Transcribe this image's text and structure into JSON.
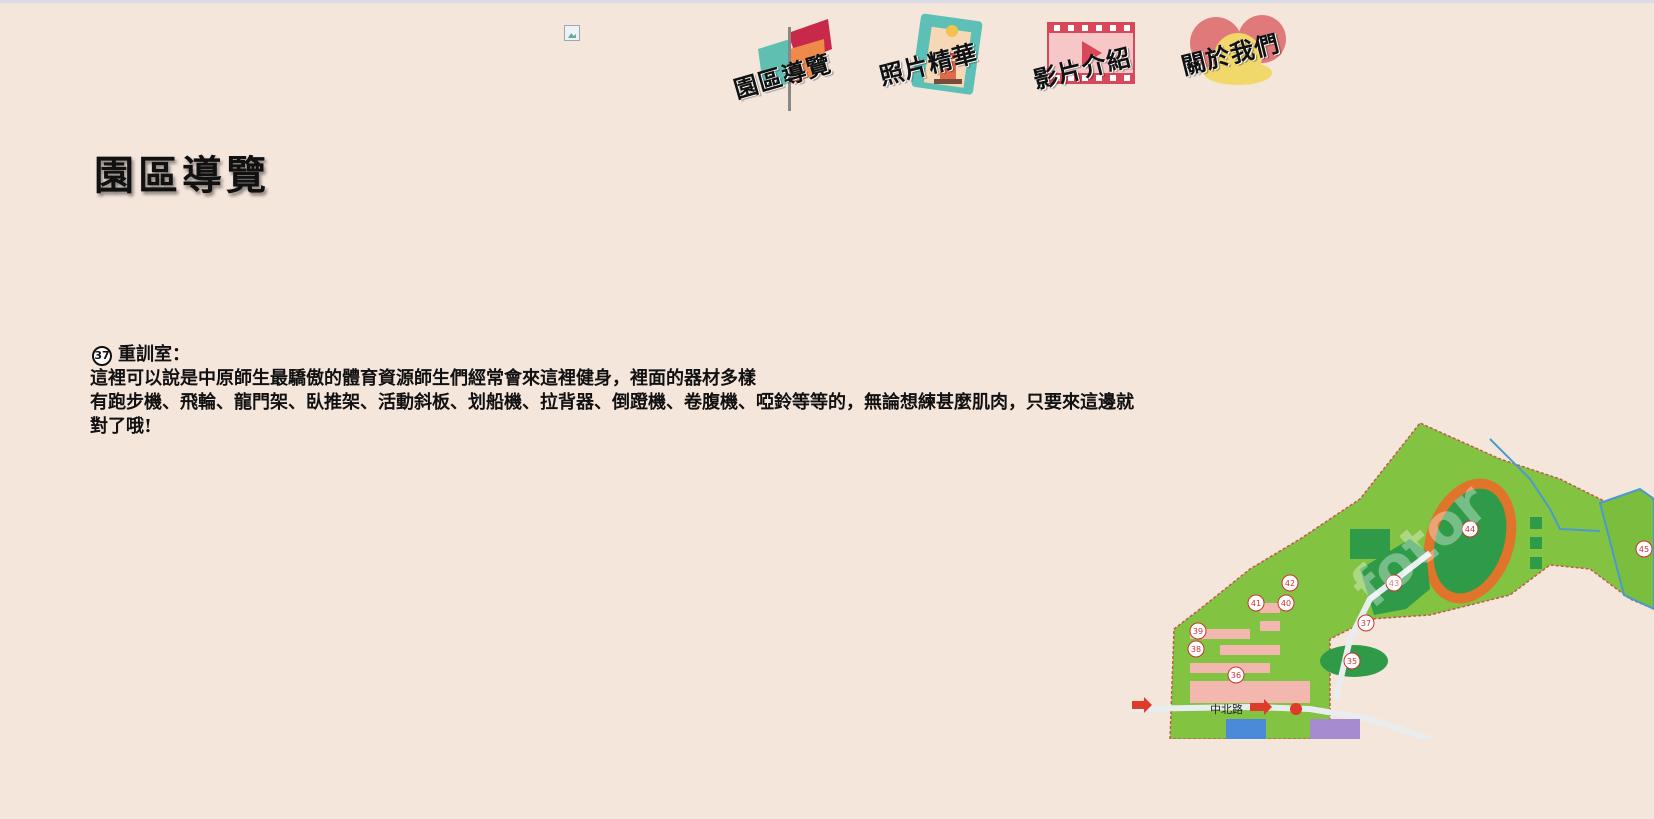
{
  "nav": {
    "items": [
      {
        "label": "園區導覽"
      },
      {
        "label": "照片精華"
      },
      {
        "label": "影片介紹"
      },
      {
        "label": "關於我們"
      }
    ]
  },
  "page": {
    "title": "園區導覽"
  },
  "entry": {
    "number": "37",
    "name": "重訓室：",
    "line1": "這裡可以說是中原師生最驕傲的體育資源師生們經常會來這裡健身，裡面的器材多樣",
    "line2": "有跑步機、飛輪、龍門架、臥推架、活動斜板、划船機、拉背器、倒蹬機、卷腹機、啞鈴等等的，無論想練甚麼肌肉，只要來這邊就",
    "line3": "對了哦!"
  },
  "map": {
    "road_label": "中北路",
    "watermark": "fotor",
    "markers": [
      "44",
      "45",
      "43",
      "42",
      "41",
      "40",
      "39",
      "38",
      "37",
      "36",
      "35"
    ]
  },
  "colors": {
    "background": "#f5e6dc",
    "grass": "#82c341",
    "track": "#e0742a",
    "field": "#2f9a48"
  }
}
